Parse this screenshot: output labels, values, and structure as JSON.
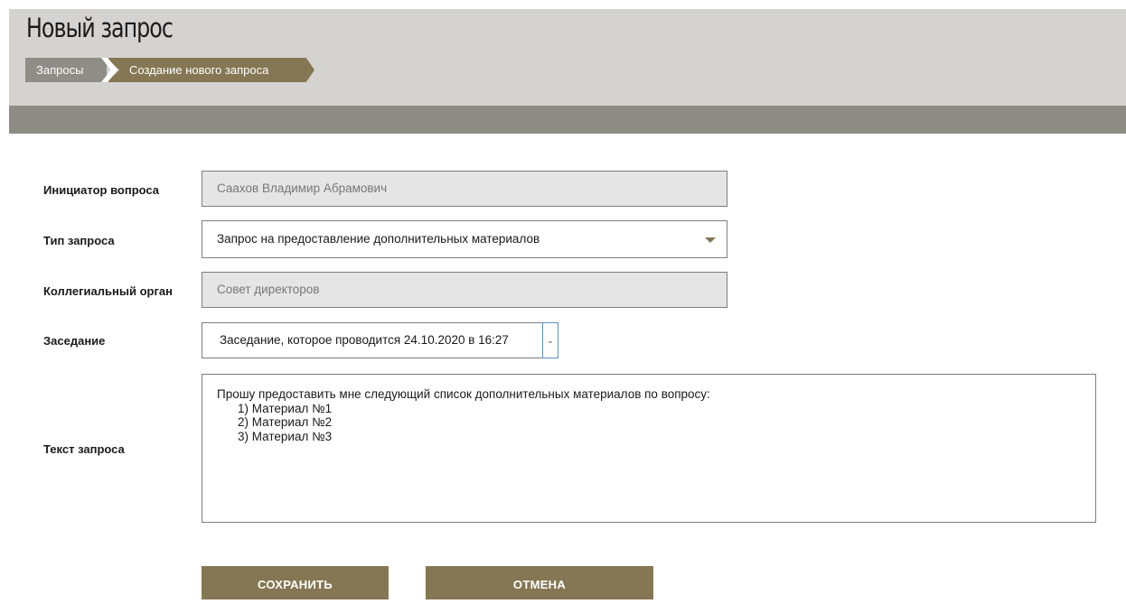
{
  "header": {
    "title": "Новый запрос",
    "breadcrumb": [
      "Запросы",
      "Создание нового запроса"
    ]
  },
  "form": {
    "initiator": {
      "label": "Инициатор вопроса",
      "value": "Саахов Владимир Абрамович"
    },
    "request_type": {
      "label": "Тип запроса",
      "value": "Запрос на предоставление дополнительных материалов"
    },
    "board": {
      "label": "Коллегиальный орган",
      "value": "Совет директоров"
    },
    "meeting": {
      "label": "Заседание",
      "value": "Заседание, которое проводится 24.10.2020 в 16:27"
    },
    "request_text": {
      "label": "Текст запроса",
      "lines": [
        "Прошу предоставить мне следующий список дополнительных материалов по вопросу:",
        "1) Материал №1",
        "2) Материал №2",
        "3) Материал №3"
      ]
    }
  },
  "actions": {
    "save": "СОХРАНИТЬ",
    "cancel": "ОТМЕНА"
  },
  "colors": {
    "accent": "#857754",
    "header_bg": "#d4d3cf",
    "bar": "#8c8b84"
  },
  "icons": {
    "type_dropdown": "caret-down-icon",
    "meeting_dropdown": "chevron-down-icon"
  }
}
